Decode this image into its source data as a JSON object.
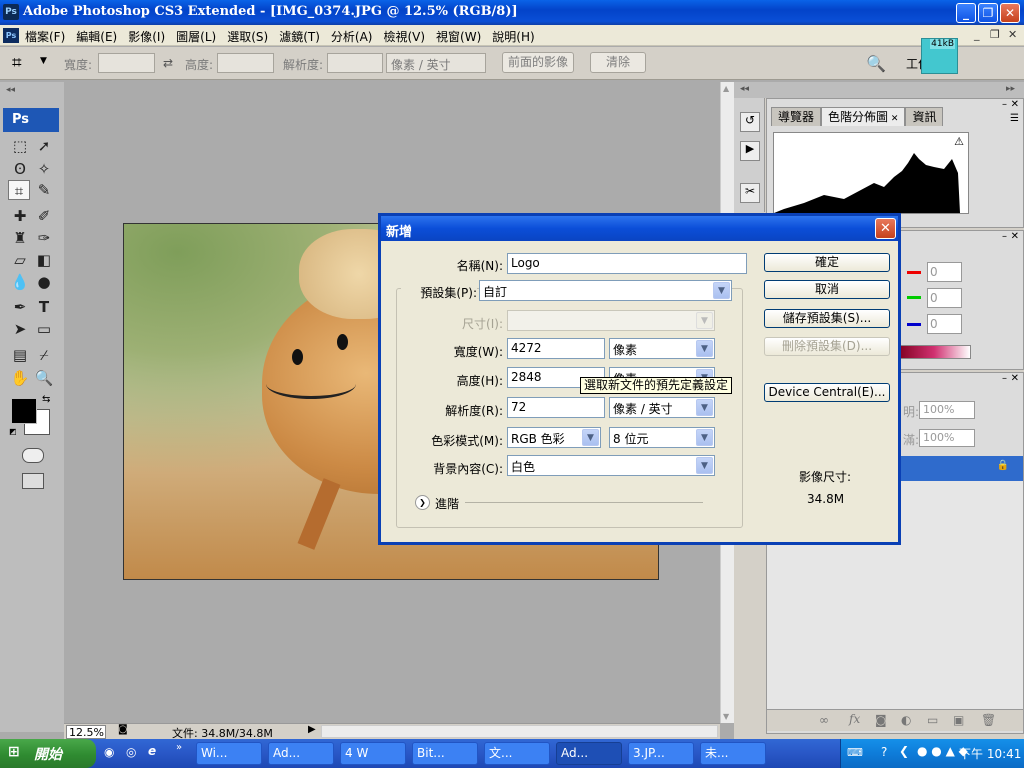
{
  "window": {
    "title": "Adobe Photoshop CS3 Extended - [IMG_0374.JPG @ 12.5% (RGB/8)]",
    "app_icon": "Ps"
  },
  "menu": {
    "icon": "Ps",
    "items": [
      "檔案(F)",
      "編輯(E)",
      "影像(I)",
      "圖層(L)",
      "選取(S)",
      "濾鏡(T)",
      "分析(A)",
      "檢視(V)",
      "視窗(W)",
      "說明(H)"
    ]
  },
  "options_bar": {
    "width_label": "寬度:",
    "height_label": "高度:",
    "resolution_label": "解析度:",
    "resolution_unit": "像素 / 英寸",
    "front_image_button": "前面的影像",
    "clear_button": "清除",
    "workspace_label": "工作區",
    "file_size_badge": "41kB"
  },
  "toolbox": {
    "header": "Ps"
  },
  "status_bar": {
    "zoom": "12.5%",
    "doc_info": "文件: 34.8M/34.8M"
  },
  "panels": {
    "tabs": [
      "導覽器",
      "色階分佈圖",
      "資訊"
    ],
    "color_values": [
      "0",
      "0",
      "0"
    ],
    "opacity_label": "明:",
    "opacity_value": "100%",
    "fill_label": "滿:",
    "fill_value": "100%"
  },
  "dialog": {
    "title": "新增",
    "name_label": "名稱(N):",
    "name_value": "Logo",
    "preset_label": "預設集(P):",
    "preset_value": "自訂",
    "size_label": "尺寸(I):",
    "width_label": "寬度(W):",
    "width_value": "4272",
    "width_unit": "像素",
    "height_label": "高度(H):",
    "height_value": "2848",
    "height_unit": "像素",
    "resolution_label": "解析度(R):",
    "resolution_value": "72",
    "resolution_unit": "像素 / 英寸",
    "color_mode_label": "色彩模式(M):",
    "color_mode_value": "RGB 色彩",
    "bit_depth_value": "8 位元",
    "background_label": "背景內容(C):",
    "background_value": "白色",
    "advanced_label": "進階",
    "ok_button": "確定",
    "cancel_button": "取消",
    "save_preset_button": "儲存預設集(S)...",
    "delete_preset_button": "刪除預設集(D)...",
    "device_central_button": "Device Central(E)...",
    "image_size_label": "影像尺寸:",
    "image_size_value": "34.8M",
    "tooltip": "選取新文件的預先定義設定"
  },
  "taskbar": {
    "start_label": "開始",
    "tasks": [
      "Wi...",
      "Ad...",
      "4 W",
      "Bit...",
      "文...",
      "Ad...",
      "3.JP...",
      "未..."
    ],
    "clock": "下午 10:41"
  },
  "colors": {
    "titlebar": "#0a4fd6",
    "dialog_border": "#0a40b5",
    "taskbar": "#2957c6",
    "start_button": "#2f8b31"
  }
}
